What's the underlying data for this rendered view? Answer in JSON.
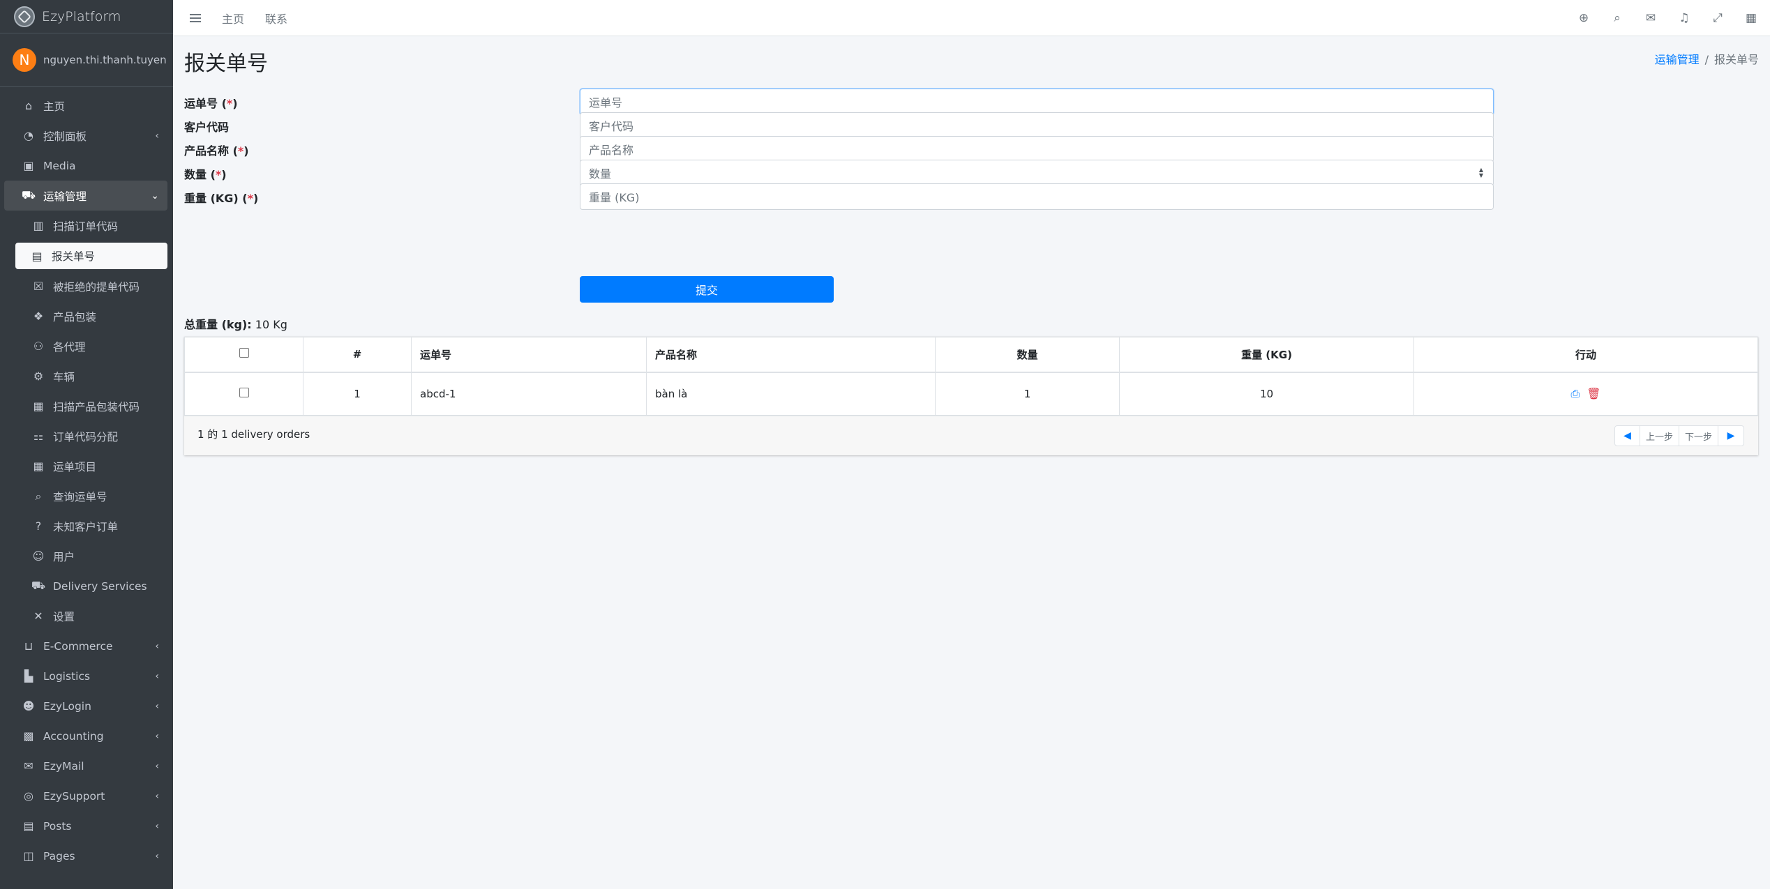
{
  "brand": {
    "name": "EzyPlatform"
  },
  "user": {
    "initial": "N",
    "name": "nguyen.thi.thanh.tuyen"
  },
  "sidebar": {
    "items": [
      {
        "label": "主页",
        "icon": "home-icon",
        "glyph": "⌂"
      },
      {
        "label": "控制面板",
        "icon": "dashboard-icon",
        "glyph": "◔",
        "arrow": "‹"
      },
      {
        "label": "Media",
        "icon": "image-icon",
        "glyph": "▣"
      },
      {
        "label": "运输管理",
        "icon": "truck-icon",
        "glyph": "⛟",
        "arrow": "⌄"
      },
      {
        "label": "扫描订单代码",
        "icon": "barcode-icon",
        "glyph": "▥"
      },
      {
        "label": "报关单号",
        "icon": "file-icon",
        "glyph": "▤"
      },
      {
        "label": "被拒绝的提单代码",
        "icon": "close-box-icon",
        "glyph": "☒"
      },
      {
        "label": "产品包装",
        "icon": "cubes-icon",
        "glyph": "❖"
      },
      {
        "label": "各代理",
        "icon": "handshake-icon",
        "glyph": "⚇"
      },
      {
        "label": "车辆",
        "icon": "motorcycle-icon",
        "glyph": "⚙"
      },
      {
        "label": "扫描产品包装代码",
        "icon": "qrcode-icon",
        "glyph": "▦"
      },
      {
        "label": "订单代码分配",
        "icon": "sitemap-icon",
        "glyph": "⚏"
      },
      {
        "label": "运单项目",
        "icon": "grid-icon",
        "glyph": "▦"
      },
      {
        "label": "查询运单号",
        "icon": "search-icon",
        "glyph": "⌕"
      },
      {
        "label": "未知客户订单",
        "icon": "question-icon",
        "glyph": "?"
      },
      {
        "label": "用户",
        "icon": "users-icon",
        "glyph": "☺"
      },
      {
        "label": "Delivery Services",
        "icon": "truck-icon",
        "glyph": "⛟"
      },
      {
        "label": "设置",
        "icon": "tools-icon",
        "glyph": "✕"
      },
      {
        "label": "E-Commerce",
        "icon": "basket-icon",
        "glyph": "⊔",
        "arrow": "‹"
      },
      {
        "label": "Logistics",
        "icon": "dolly-icon",
        "glyph": "▙",
        "arrow": "‹"
      },
      {
        "label": "EzyLogin",
        "icon": "user-lock-icon",
        "glyph": "☻",
        "arrow": "‹"
      },
      {
        "label": "Accounting",
        "icon": "calculator-icon",
        "glyph": "▩",
        "arrow": "‹"
      },
      {
        "label": "EzyMail",
        "icon": "envelope-icon",
        "glyph": "✉",
        "arrow": "‹"
      },
      {
        "label": "EzySupport",
        "icon": "life-ring-icon",
        "glyph": "◎",
        "arrow": "‹"
      },
      {
        "label": "Posts",
        "icon": "newspaper-icon",
        "glyph": "▤",
        "arrow": "‹"
      },
      {
        "label": "Pages",
        "icon": "columns-icon",
        "glyph": "◫",
        "arrow": "‹"
      }
    ]
  },
  "topbar": {
    "home": "主页",
    "contact": "联系"
  },
  "page": {
    "title": "报关单号",
    "breadcrumb": {
      "parent": "运输管理",
      "current": "报关单号"
    }
  },
  "form": {
    "waybill": {
      "label": "运单号",
      "placeholder": "运单号"
    },
    "customer_code": {
      "label": "客户代码",
      "placeholder": "客户代码"
    },
    "product_name": {
      "label": "产品名称",
      "placeholder": "产品名称"
    },
    "quantity": {
      "label": "数量",
      "placeholder": "数量"
    },
    "weight": {
      "label": "重量 (KG)",
      "placeholder": "重量 (KG)"
    },
    "required_mark": "(*)",
    "submit": "提交"
  },
  "total": {
    "label": "总重量 (kg):",
    "value": "10 Kg"
  },
  "table": {
    "headers": [
      "#",
      "运单号",
      "产品名称",
      "数量",
      "重量 (KG)",
      "行动"
    ],
    "rows": [
      {
        "index": "1",
        "waybill": "abcd-1",
        "product": "bàn là",
        "quantity": "1",
        "weight": "10"
      }
    ],
    "footer": "1 的 1 delivery orders",
    "prev": "上一步",
    "next": "下一步"
  }
}
